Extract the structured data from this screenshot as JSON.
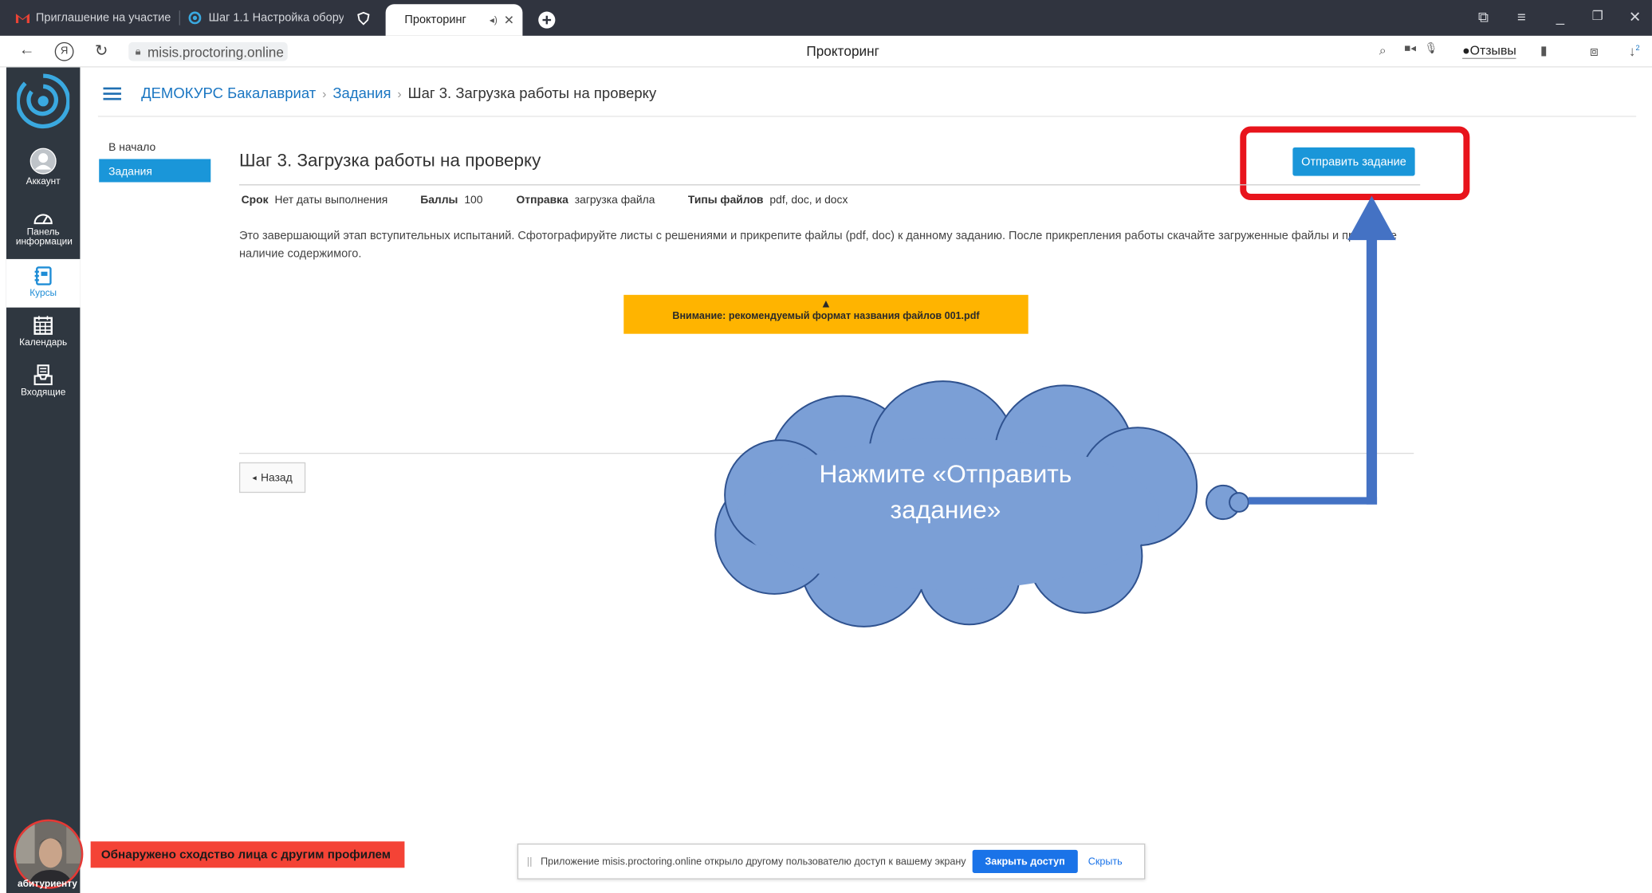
{
  "browser": {
    "tabs": [
      {
        "label": "Приглашение на участие",
        "icon": "gmail-icon"
      },
      {
        "label": "Шаг 1.1 Настройка обору",
        "icon": "proctoring-favicon"
      },
      {
        "label": "",
        "icon": "shield-icon"
      },
      {
        "label": "Проктoринг",
        "icon": "",
        "active": true
      }
    ],
    "url": "misis.proctoring.online",
    "page_title": "Проктoринг",
    "feedback_label": "Отзывы",
    "download_badge": "2",
    "yandex_glyph": "Я"
  },
  "rail": {
    "items": [
      {
        "label": "Аккаунт",
        "icon": "account-icon"
      },
      {
        "label": "Панель информации",
        "icon": "dashboard-icon"
      },
      {
        "label": "Курсы",
        "icon": "courses-icon",
        "active": true
      },
      {
        "label": "Календарь",
        "icon": "calendar-icon"
      },
      {
        "label": "Входящие",
        "icon": "inbox-icon"
      }
    ],
    "face_name": "абитуриенту",
    "face_alert": "Обнаружено сходство лица с другим профилем"
  },
  "breadcrumb": {
    "course": "ДЕМОКУРС Бакалавриат",
    "section": "Задания",
    "current": "Шаг 3. Загрузка работы на проверку"
  },
  "subnav": {
    "home": "В начало",
    "assignments": "Задания"
  },
  "assignment": {
    "title": "Шаг 3. Загрузка работы на проверку",
    "submit_label": "Отправить задание",
    "due_label": "Срок",
    "due_value": "Нет даты выполнения",
    "points_label": "Баллы",
    "points_value": "100",
    "submission_label": "Отправка",
    "submission_value": "загрузка файла",
    "filetypes_label": "Типы файлов",
    "filetypes_value": "pdf, doc, и docx",
    "description": "Это завершающий этап вступительных испытаний. Сфотографируйте листы с решениями и прикрепите файлы (pdf, doc) к данному заданию. После прикрепления работы скачайте загруженные файлы и проверьте наличие содержимого.",
    "warning": "Внимание: рекомендуемый формат названия файлов 001.pdf",
    "back_label": "Назад"
  },
  "annotation": {
    "callout_text": "Нажмите «Отправить задание»",
    "arrow_color": "#4472c4",
    "cloud_color": "#7b9fd6",
    "highlight_color": "#e8141c"
  },
  "screen_share": {
    "message": "Приложение misis.proctoring.online открыло другому пользователю доступ к вашему экрану",
    "stop_label": "Закрыть доступ",
    "hide_label": "Скрыть"
  },
  "colors": {
    "accent": "#1a96d9",
    "link": "#1a76c2",
    "rail": "#2f3740",
    "warning_bg": "#ffb400"
  }
}
